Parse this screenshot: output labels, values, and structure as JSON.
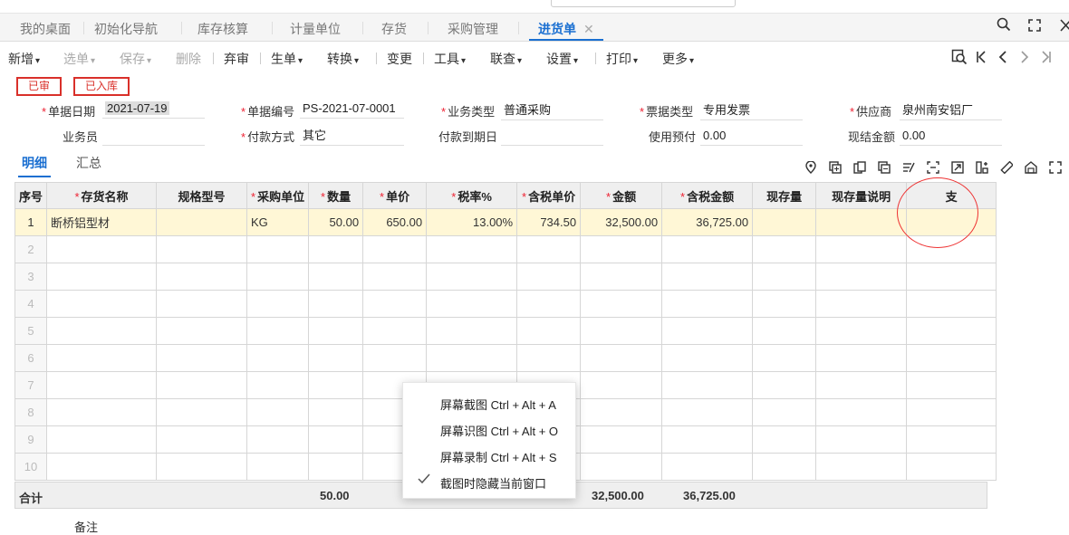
{
  "tabs": [
    {
      "label": "我的桌面",
      "active": false
    },
    {
      "label": "初始化导航",
      "active": false
    },
    {
      "label": "库存核算",
      "active": false
    },
    {
      "label": "计量单位",
      "active": false
    },
    {
      "label": "存货",
      "active": false
    },
    {
      "label": "采购管理",
      "active": false
    },
    {
      "label": "进货单",
      "active": true
    }
  ],
  "tab_close": "✕",
  "window_controls": {
    "search": "🔍",
    "max": "⛶",
    "close": "✕"
  },
  "toolbar": {
    "add": "新增",
    "select": "选单",
    "save": "保存",
    "delete": "删除",
    "abandon": "弃审",
    "generate": "生单",
    "convert": "转换",
    "change": "变更",
    "tools": "工具",
    "lookup": "联查",
    "settings": "设置",
    "print": "打印",
    "more": "更多"
  },
  "stamps": {
    "audited": "已审",
    "stocked": "已入库"
  },
  "form": {
    "doc_date_label": "单据日期",
    "doc_date": "2021-07-19",
    "doc_no_label": "单据编号",
    "doc_no": "PS-2021-07-0001",
    "biz_type_label": "业务类型",
    "biz_type": "普通采购",
    "invoice_type_label": "票据类型",
    "invoice_type": "专用发票",
    "supplier_label": "供应商",
    "supplier": "泉州南安铝厂",
    "salesman_label": "业务员",
    "salesman": "",
    "pay_method_label": "付款方式",
    "pay_method": "其它",
    "pay_due_label": "付款到期日",
    "pay_due": "",
    "prepay_label": "使用预付",
    "prepay": "0.00",
    "cash_label": "现结金额",
    "cash": "0.00"
  },
  "subtabs": {
    "detail": "明细",
    "summary": "汇总"
  },
  "grid": {
    "headers": {
      "seq": "序号",
      "name": "存货名称",
      "spec": "规格型号",
      "unit": "采购单位",
      "qty": "数量",
      "price": "单价",
      "tax_rate": "税率%",
      "tax_price": "含税单价",
      "amount": "金额",
      "tax_amount": "含税金额",
      "stock": "现存量",
      "stock_note": "现存量说明",
      "extra": "支"
    },
    "rows": [
      {
        "seq": "1",
        "name": "断桥铝型材",
        "spec": "",
        "unit": "KG",
        "qty": "50.00",
        "price": "650.00",
        "tax_rate": "13.00%",
        "tax_price": "734.50",
        "amount": "32,500.00",
        "tax_amount": "36,725.00",
        "stock": "",
        "stock_note": "",
        "extra": ""
      },
      {
        "seq": "2"
      },
      {
        "seq": "3"
      },
      {
        "seq": "4"
      },
      {
        "seq": "5"
      },
      {
        "seq": "6"
      },
      {
        "seq": "7"
      },
      {
        "seq": "8"
      },
      {
        "seq": "9"
      },
      {
        "seq": "10"
      }
    ],
    "total": {
      "label": "合计",
      "qty": "50.00",
      "amount": "32,500.00",
      "tax_amount": "36,725.00"
    }
  },
  "remark_label": "备注",
  "context_menu": [
    {
      "label": "屏幕截图 Ctrl + Alt + A",
      "checked": false
    },
    {
      "label": "屏幕识图 Ctrl + Alt + O",
      "checked": false
    },
    {
      "label": "屏幕录制 Ctrl + Alt + S",
      "checked": false
    },
    {
      "label": "截图时隐藏当前窗口",
      "checked": true
    }
  ]
}
